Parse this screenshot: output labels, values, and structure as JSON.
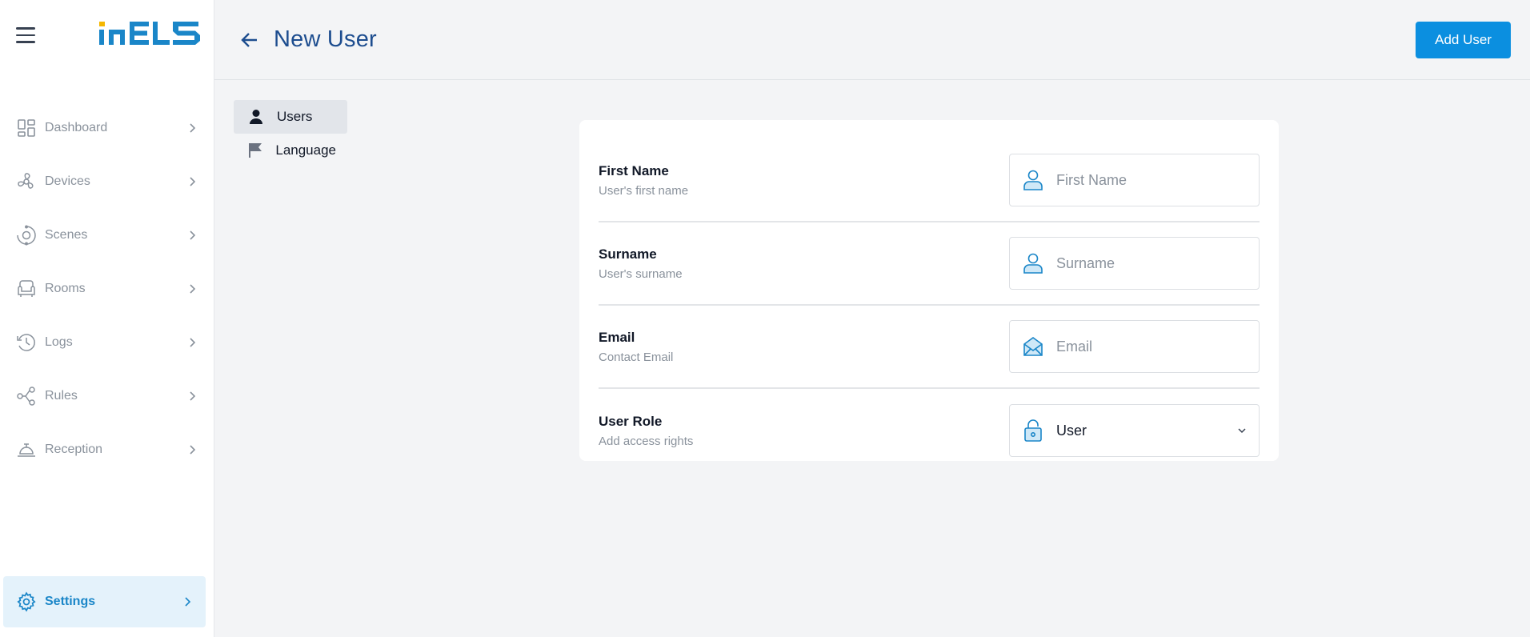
{
  "sidebar": {
    "logo_text": "iNELS",
    "items": [
      {
        "label": "Dashboard",
        "icon": "dashboard-icon"
      },
      {
        "label": "Devices",
        "icon": "devices-icon"
      },
      {
        "label": "Scenes",
        "icon": "scenes-icon"
      },
      {
        "label": "Rooms",
        "icon": "rooms-icon"
      },
      {
        "label": "Logs",
        "icon": "logs-icon"
      },
      {
        "label": "Rules",
        "icon": "rules-icon"
      },
      {
        "label": "Reception",
        "icon": "reception-icon"
      }
    ],
    "settings_label": "Settings"
  },
  "header": {
    "title": "New User",
    "add_button": "Add User"
  },
  "subnav": {
    "items": [
      {
        "label": "Users",
        "active": true
      },
      {
        "label": "Language",
        "active": false
      }
    ]
  },
  "form": {
    "first_name": {
      "label": "First Name",
      "desc": "User's first name",
      "placeholder": "First Name"
    },
    "surname": {
      "label": "Surname",
      "desc": "User's surname",
      "placeholder": "Surname"
    },
    "email": {
      "label": "Email",
      "desc": "Contact Email",
      "placeholder": "Email"
    },
    "role": {
      "label": "User Role",
      "desc": "Add access rights",
      "value": "User"
    }
  },
  "colors": {
    "accent": "#0b8fe0",
    "title": "#1d4d8f",
    "settings_bg": "#e4f2fb"
  }
}
